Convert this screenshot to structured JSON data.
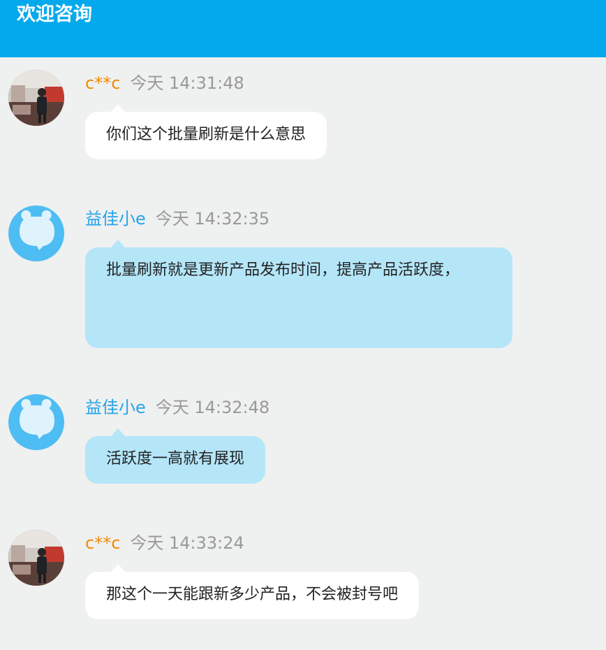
{
  "header": {
    "title": "欢迎咨询"
  },
  "messages": [
    {
      "sender": "c**c",
      "sender_role": "user",
      "time": "今天 14:31:48",
      "text": "你们这个批量刷新是什么意思"
    },
    {
      "sender": "益佳小e",
      "sender_role": "agent",
      "time": "今天 14:32:35",
      "text": "批量刷新就是更新产品发布时间，提高产品活跃度，"
    },
    {
      "sender": "益佳小e",
      "sender_role": "agent",
      "time": "今天 14:32:48",
      "text": "活跃度一高就有展现"
    },
    {
      "sender": "c**c",
      "sender_role": "user",
      "time": "今天 14:33:24",
      "text": "那这个一天能跟新多少产品，不会被封号吧"
    }
  ],
  "colors": {
    "header_bg": "#03a9ec",
    "page_bg": "#eff0f0",
    "user_name": "#f08a00",
    "agent_name": "#27a4ea",
    "agent_bubble": "#b4e6f8",
    "user_bubble": "#ffffff"
  },
  "icons": {
    "user_avatar": "user-photo-avatar",
    "agent_avatar": "bear-avatar-icon"
  }
}
